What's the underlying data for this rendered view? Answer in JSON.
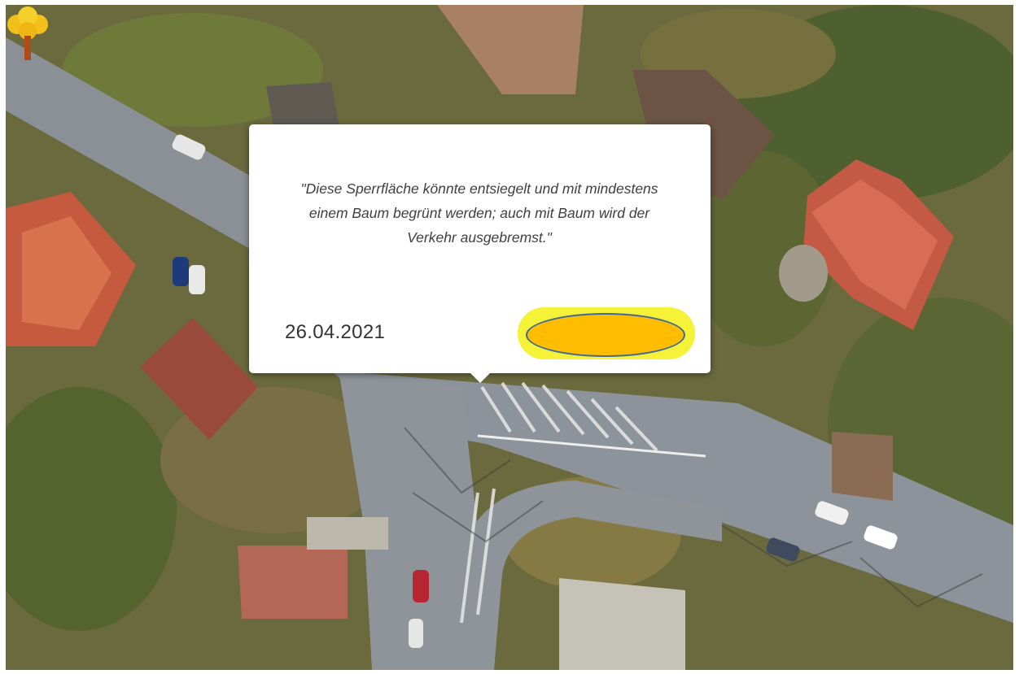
{
  "popup": {
    "quote": "\"Diese Sperrfläche könnte entsiegelt und mit mindestens einem Baum begrünt werden; auch mit Baum wird der Verkehr ausgebremst.\"",
    "date": "26.04.2021"
  },
  "colors": {
    "road": "#8d939a",
    "vegetation": "#5f6b32",
    "roof_red": "#c65a3e",
    "button_outer": "#f5f238",
    "button_inner": "#ffbd00",
    "marker_tree": "#f2c01a"
  },
  "icons": {
    "marker": "tree-icon"
  }
}
